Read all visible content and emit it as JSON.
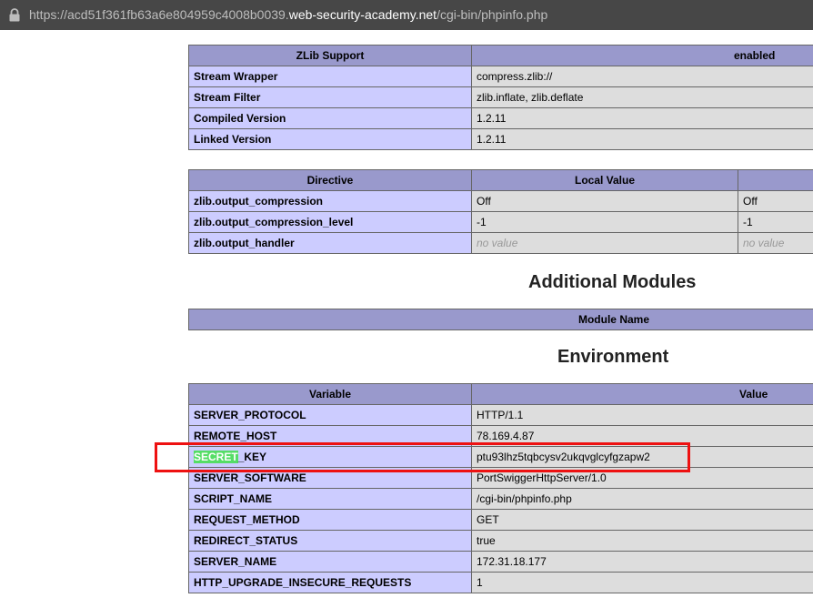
{
  "browser": {
    "url_prefix": "https://acd51f361fb63a6e804959c4008b0039.",
    "url_host": "web-security-academy.net",
    "url_path": "/cgi-bin/phpinfo.php"
  },
  "zlib": {
    "header_left": "ZLib Support",
    "header_right": "enabled",
    "rows": [
      {
        "name": "Stream Wrapper",
        "value": "compress.zlib://"
      },
      {
        "name": "Stream Filter",
        "value": "zlib.inflate, zlib.deflate"
      },
      {
        "name": "Compiled Version",
        "value": "1.2.11"
      },
      {
        "name": "Linked Version",
        "value": "1.2.11"
      }
    ]
  },
  "directives": {
    "headers": [
      "Directive",
      "Local Value"
    ],
    "rows": [
      {
        "name": "zlib.output_compression",
        "local": "Off",
        "master": "Off"
      },
      {
        "name": "zlib.output_compression_level",
        "local": "-1",
        "master": "-1"
      },
      {
        "name": "zlib.output_handler",
        "local": "no value",
        "master": "no value"
      }
    ]
  },
  "additional_modules": {
    "title": "Additional Modules",
    "header": "Module Name"
  },
  "environment": {
    "title": "Environment",
    "headers": [
      "Variable",
      "Value"
    ],
    "rows": [
      {
        "name": "SERVER_PROTOCOL",
        "value": "HTTP/1.1"
      },
      {
        "name": "REMOTE_HOST",
        "value": "78.169.4.87"
      },
      {
        "name_highlight": "SECRET",
        "name_rest": "_KEY",
        "value": "ptu93lhz5tqbcysv2ukqvglcyfgzapw2"
      },
      {
        "name": "SERVER_SOFTWARE",
        "value": "PortSwiggerHttpServer/1.0"
      },
      {
        "name": "SCRIPT_NAME",
        "value": "/cgi-bin/phpinfo.php"
      },
      {
        "name": "REQUEST_METHOD",
        "value": "GET"
      },
      {
        "name": "REDIRECT_STATUS",
        "value": "true"
      },
      {
        "name": "SERVER_NAME",
        "value": "172.31.18.177"
      },
      {
        "name": "HTTP_UPGRADE_INSECURE_REQUESTS",
        "value": "1"
      }
    ]
  }
}
